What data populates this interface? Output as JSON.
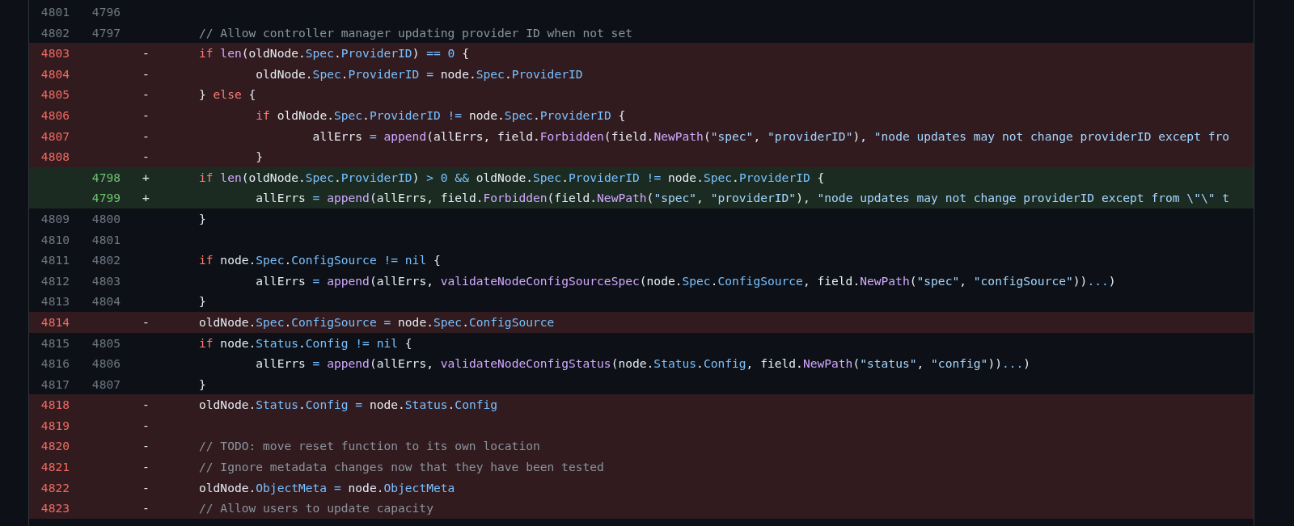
{
  "diff": {
    "rows": [
      {
        "kind": "context",
        "old": "4801",
        "new": "4796",
        "tokens": []
      },
      {
        "kind": "context",
        "old": "4802",
        "new": "4797",
        "tokens": [
          {
            "text": "// Allow controller manager updating provider ID when not set",
            "kind": "comment"
          }
        ]
      },
      {
        "kind": "deletion",
        "old": "4803",
        "sign": "-",
        "tokens": [
          {
            "text": "if ",
            "kind": "keyword"
          },
          {
            "text": "len",
            "kind": "function"
          },
          {
            "text": "(oldNode.",
            "kind": "plain"
          },
          {
            "text": "Spec",
            "kind": "constant"
          },
          {
            "text": ".",
            "kind": "plain"
          },
          {
            "text": "ProviderID",
            "kind": "constant"
          },
          {
            "text": ") ",
            "kind": "plain"
          },
          {
            "text": "== 0",
            "kind": "constant"
          },
          {
            "text": " {",
            "kind": "plain"
          }
        ]
      },
      {
        "kind": "deletion",
        "old": "4804",
        "sign": "-",
        "tokens": [
          {
            "text": "\toldNode.",
            "kind": "plain"
          },
          {
            "text": "Spec",
            "kind": "constant"
          },
          {
            "text": ".",
            "kind": "plain"
          },
          {
            "text": "ProviderID ",
            "kind": "constant"
          },
          {
            "text": "=",
            "kind": "constant"
          },
          {
            "text": " node.",
            "kind": "plain"
          },
          {
            "text": "Spec",
            "kind": "constant"
          },
          {
            "text": ".",
            "kind": "plain"
          },
          {
            "text": "ProviderID",
            "kind": "constant"
          }
        ]
      },
      {
        "kind": "deletion",
        "old": "4805",
        "sign": "-",
        "tokens": [
          {
            "text": "} ",
            "kind": "plain"
          },
          {
            "text": "else",
            "kind": "keyword"
          },
          {
            "text": " {",
            "kind": "plain"
          }
        ]
      },
      {
        "kind": "deletion",
        "old": "4806",
        "sign": "-",
        "tokens": [
          {
            "text": "\tif",
            "kind": "keyword"
          },
          {
            "text": " oldNode.",
            "kind": "plain"
          },
          {
            "text": "Spec",
            "kind": "constant"
          },
          {
            "text": ".",
            "kind": "plain"
          },
          {
            "text": "ProviderID != ",
            "kind": "constant"
          },
          {
            "text": "node.",
            "kind": "plain"
          },
          {
            "text": "Spec",
            "kind": "constant"
          },
          {
            "text": ".",
            "kind": "plain"
          },
          {
            "text": "ProviderID",
            "kind": "constant"
          },
          {
            "text": " {",
            "kind": "plain"
          }
        ]
      },
      {
        "kind": "deletion",
        "old": "4807",
        "sign": "-",
        "tokens": [
          {
            "text": "\t\tallErrs ",
            "kind": "plain"
          },
          {
            "text": "= ",
            "kind": "constant"
          },
          {
            "text": "append",
            "kind": "function"
          },
          {
            "text": "(allErrs, field.",
            "kind": "plain"
          },
          {
            "text": "Forbidden",
            "kind": "function"
          },
          {
            "text": "(field.",
            "kind": "plain"
          },
          {
            "text": "NewPath",
            "kind": "function"
          },
          {
            "text": "(",
            "kind": "plain"
          },
          {
            "text": "\"spec\"",
            "kind": "string"
          },
          {
            "text": ", ",
            "kind": "plain"
          },
          {
            "text": "\"providerID\"",
            "kind": "string"
          },
          {
            "text": "), ",
            "kind": "plain"
          },
          {
            "text": "\"node updates may not change providerID except fro",
            "kind": "string"
          }
        ]
      },
      {
        "kind": "deletion",
        "old": "4808",
        "sign": "-",
        "tokens": [
          {
            "text": "\t}",
            "kind": "plain"
          }
        ]
      },
      {
        "kind": "addition",
        "new": "4798",
        "sign": "+",
        "tokens": [
          {
            "text": "if ",
            "kind": "keyword"
          },
          {
            "text": "len",
            "kind": "function"
          },
          {
            "text": "(oldNode.",
            "kind": "plain"
          },
          {
            "text": "Spec",
            "kind": "constant"
          },
          {
            "text": ".",
            "kind": "plain"
          },
          {
            "text": "ProviderID",
            "kind": "constant"
          },
          {
            "text": ") ",
            "kind": "plain"
          },
          {
            "text": "> 0 && ",
            "kind": "constant"
          },
          {
            "text": "oldNode.",
            "kind": "plain"
          },
          {
            "text": "Spec",
            "kind": "constant"
          },
          {
            "text": ".",
            "kind": "plain"
          },
          {
            "text": "ProviderID != ",
            "kind": "constant"
          },
          {
            "text": "node.",
            "kind": "plain"
          },
          {
            "text": "Spec",
            "kind": "constant"
          },
          {
            "text": ".",
            "kind": "plain"
          },
          {
            "text": "ProviderID",
            "kind": "constant"
          },
          {
            "text": " {",
            "kind": "plain"
          }
        ]
      },
      {
        "kind": "addition",
        "new": "4799",
        "sign": "+",
        "tokens": [
          {
            "text": "\tallErrs ",
            "kind": "plain"
          },
          {
            "text": "= ",
            "kind": "constant"
          },
          {
            "text": "append",
            "kind": "function"
          },
          {
            "text": "(allErrs, field.",
            "kind": "plain"
          },
          {
            "text": "Forbidden",
            "kind": "function"
          },
          {
            "text": "(field.",
            "kind": "plain"
          },
          {
            "text": "NewPath",
            "kind": "function"
          },
          {
            "text": "(",
            "kind": "plain"
          },
          {
            "text": "\"spec\"",
            "kind": "string"
          },
          {
            "text": ", ",
            "kind": "plain"
          },
          {
            "text": "\"providerID\"",
            "kind": "string"
          },
          {
            "text": "), ",
            "kind": "plain"
          },
          {
            "text": "\"node updates may not change providerID except from \\\"\\\" t",
            "kind": "string"
          }
        ]
      },
      {
        "kind": "context",
        "old": "4809",
        "new": "4800",
        "tokens": [
          {
            "text": "}",
            "kind": "plain"
          }
        ]
      },
      {
        "kind": "context",
        "old": "4810",
        "new": "4801",
        "tokens": []
      },
      {
        "kind": "context",
        "old": "4811",
        "new": "4802",
        "tokens": [
          {
            "text": "if",
            "kind": "keyword"
          },
          {
            "text": " node.",
            "kind": "plain"
          },
          {
            "text": "Spec",
            "kind": "constant"
          },
          {
            "text": ".",
            "kind": "plain"
          },
          {
            "text": "ConfigSource != nil",
            "kind": "constant"
          },
          {
            "text": " {",
            "kind": "plain"
          }
        ]
      },
      {
        "kind": "context",
        "old": "4812",
        "new": "4803",
        "tokens": [
          {
            "text": "\tallErrs ",
            "kind": "plain"
          },
          {
            "text": "= ",
            "kind": "constant"
          },
          {
            "text": "append",
            "kind": "function"
          },
          {
            "text": "(allErrs, ",
            "kind": "plain"
          },
          {
            "text": "validateNodeConfigSourceSpec",
            "kind": "function"
          },
          {
            "text": "(node.",
            "kind": "plain"
          },
          {
            "text": "Spec",
            "kind": "constant"
          },
          {
            "text": ".",
            "kind": "plain"
          },
          {
            "text": "ConfigSource",
            "kind": "constant"
          },
          {
            "text": ", field.",
            "kind": "plain"
          },
          {
            "text": "NewPath",
            "kind": "function"
          },
          {
            "text": "(",
            "kind": "plain"
          },
          {
            "text": "\"spec\"",
            "kind": "string"
          },
          {
            "text": ", ",
            "kind": "plain"
          },
          {
            "text": "\"configSource\"",
            "kind": "string"
          },
          {
            "text": "))",
            "kind": "plain"
          },
          {
            "text": "...",
            "kind": "constant"
          },
          {
            "text": ")",
            "kind": "plain"
          }
        ]
      },
      {
        "kind": "context",
        "old": "4813",
        "new": "4804",
        "tokens": [
          {
            "text": "}",
            "kind": "plain"
          }
        ]
      },
      {
        "kind": "deletion",
        "old": "4814",
        "sign": "-",
        "tokens": [
          {
            "text": "oldNode.",
            "kind": "plain"
          },
          {
            "text": "Spec",
            "kind": "constant"
          },
          {
            "text": ".",
            "kind": "plain"
          },
          {
            "text": "ConfigSource = ",
            "kind": "constant"
          },
          {
            "text": "node.",
            "kind": "plain"
          },
          {
            "text": "Spec",
            "kind": "constant"
          },
          {
            "text": ".",
            "kind": "plain"
          },
          {
            "text": "ConfigSource",
            "kind": "constant"
          }
        ]
      },
      {
        "kind": "context",
        "old": "4815",
        "new": "4805",
        "tokens": [
          {
            "text": "if",
            "kind": "keyword"
          },
          {
            "text": " node.",
            "kind": "plain"
          },
          {
            "text": "Status",
            "kind": "constant"
          },
          {
            "text": ".",
            "kind": "plain"
          },
          {
            "text": "Config != nil",
            "kind": "constant"
          },
          {
            "text": " {",
            "kind": "plain"
          }
        ]
      },
      {
        "kind": "context",
        "old": "4816",
        "new": "4806",
        "tokens": [
          {
            "text": "\tallErrs ",
            "kind": "plain"
          },
          {
            "text": "= ",
            "kind": "constant"
          },
          {
            "text": "append",
            "kind": "function"
          },
          {
            "text": "(allErrs, ",
            "kind": "plain"
          },
          {
            "text": "validateNodeConfigStatus",
            "kind": "function"
          },
          {
            "text": "(node.",
            "kind": "plain"
          },
          {
            "text": "Status",
            "kind": "constant"
          },
          {
            "text": ".",
            "kind": "plain"
          },
          {
            "text": "Config",
            "kind": "constant"
          },
          {
            "text": ", field.",
            "kind": "plain"
          },
          {
            "text": "NewPath",
            "kind": "function"
          },
          {
            "text": "(",
            "kind": "plain"
          },
          {
            "text": "\"status\"",
            "kind": "string"
          },
          {
            "text": ", ",
            "kind": "plain"
          },
          {
            "text": "\"config\"",
            "kind": "string"
          },
          {
            "text": "))",
            "kind": "plain"
          },
          {
            "text": "...",
            "kind": "constant"
          },
          {
            "text": ")",
            "kind": "plain"
          }
        ]
      },
      {
        "kind": "context",
        "old": "4817",
        "new": "4807",
        "tokens": [
          {
            "text": "}",
            "kind": "plain"
          }
        ]
      },
      {
        "kind": "deletion",
        "old": "4818",
        "sign": "-",
        "tokens": [
          {
            "text": "oldNode.",
            "kind": "plain"
          },
          {
            "text": "Status",
            "kind": "constant"
          },
          {
            "text": ".",
            "kind": "plain"
          },
          {
            "text": "Config = ",
            "kind": "constant"
          },
          {
            "text": "node.",
            "kind": "plain"
          },
          {
            "text": "Status",
            "kind": "constant"
          },
          {
            "text": ".",
            "kind": "plain"
          },
          {
            "text": "Config",
            "kind": "constant"
          }
        ]
      },
      {
        "kind": "deletion",
        "old": "4819",
        "sign": "-",
        "tokens": []
      },
      {
        "kind": "deletion",
        "old": "4820",
        "sign": "-",
        "tokens": [
          {
            "text": "// TODO: move reset function to its own location",
            "kind": "comment"
          }
        ]
      },
      {
        "kind": "deletion",
        "old": "4821",
        "sign": "-",
        "tokens": [
          {
            "text": "// Ignore metadata changes now that they have been tested",
            "kind": "comment"
          }
        ]
      },
      {
        "kind": "deletion",
        "old": "4822",
        "sign": "-",
        "tokens": [
          {
            "text": "oldNode.",
            "kind": "plain"
          },
          {
            "text": "ObjectMeta = ",
            "kind": "constant"
          },
          {
            "text": "node.",
            "kind": "plain"
          },
          {
            "text": "ObjectMeta",
            "kind": "constant"
          }
        ]
      },
      {
        "kind": "deletion",
        "old": "4823",
        "sign": "-",
        "tokens": [
          {
            "text": "// Allow users to update capacity",
            "kind": "comment"
          }
        ]
      }
    ]
  }
}
